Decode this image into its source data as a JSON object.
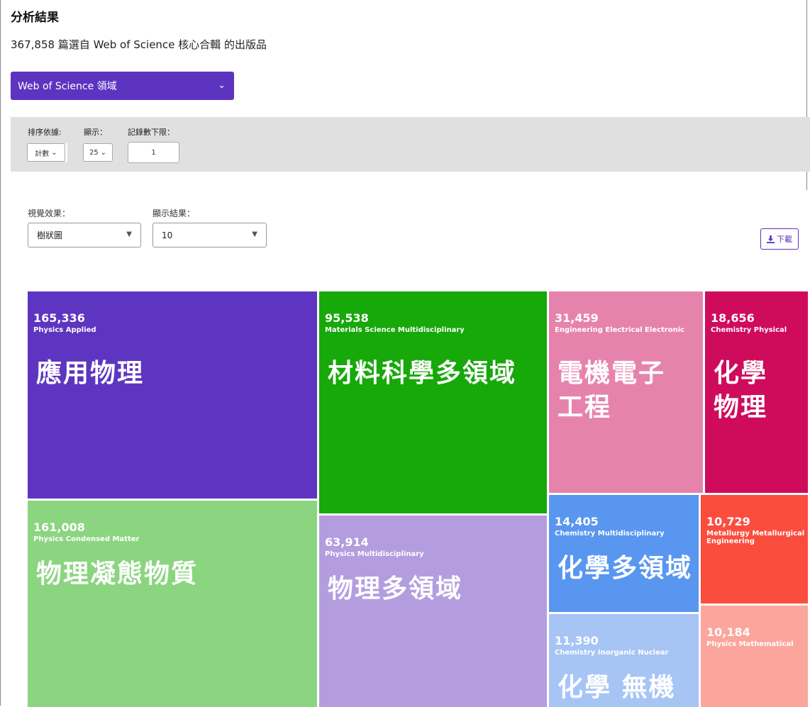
{
  "header": {
    "title": "分析結果",
    "subtitle": "367,858 篇選自 Web of Science 核心合輯 的出版品"
  },
  "field_dropdown": {
    "label": "Web of Science 領域"
  },
  "filters": {
    "sort_label": "排序依據:",
    "sort_value": "計數",
    "show_label": "顯示：",
    "show_value": "25",
    "min_label": "記錄數下限：",
    "min_value": "1"
  },
  "viz": {
    "effect_label": "視覺效果：",
    "effect_value": "樹狀圖",
    "results_label": "顯示結果：",
    "results_value": "10",
    "download_label": "下載"
  },
  "colors": {
    "accent": "#5c34c0",
    "filter_bg": "#e0e0e0"
  },
  "treemap": {
    "tiles": [
      {
        "count": "165,336",
        "en": "Physics Applied",
        "zh": "應用物理",
        "color": "#5e35c0"
      },
      {
        "count": "161,008",
        "en": "Physics Condensed Matter",
        "zh": "物理凝態物質",
        "color": "#8bd580"
      },
      {
        "count": "95,538",
        "en": "Materials Science Multidisciplinary",
        "zh": "材料科學多領域",
        "color": "#17a80a"
      },
      {
        "count": "63,914",
        "en": "Physics Multidisciplinary",
        "zh": "物理多領域",
        "color": "#b39ddf"
      },
      {
        "count": "31,459",
        "en": "Engineering Electrical Electronic",
        "zh": "電機電子工程",
        "color": "#e683ad"
      },
      {
        "count": "18,656",
        "en": "Chemistry Physical",
        "zh": "化學物理",
        "color": "#cf0b5c"
      },
      {
        "count": "14,405",
        "en": "Chemistry Multidisciplinary",
        "zh": "化學多領域",
        "color": "#5896f0"
      },
      {
        "count": "11,390",
        "en": "Chemistry Inorganic Nuclear",
        "zh": "化學 無機核",
        "color": "#a6c5f5"
      },
      {
        "count": "10,729",
        "en": "Metallurgy Metallurgical Engineering",
        "zh": "",
        "color": "#fb4d3e"
      },
      {
        "count": "10,184",
        "en": "Physics Mathematical",
        "zh": "",
        "color": "#fca59c"
      }
    ]
  }
}
